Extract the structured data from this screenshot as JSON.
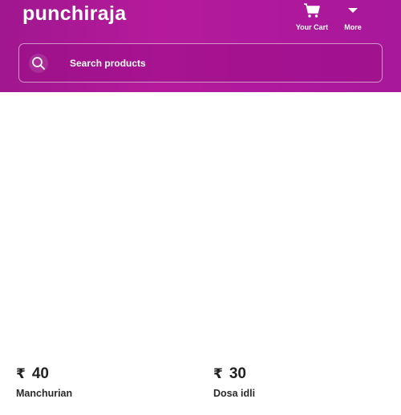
{
  "header": {
    "brand": "punchiraja",
    "nav": {
      "cart_label": "Your Cart",
      "more_label": "More"
    },
    "search": {
      "placeholder": "Search products"
    },
    "colors": {
      "header_bg": "#a8189a",
      "text": "#ffffff"
    }
  },
  "products": [
    {
      "currency": "₹",
      "price": "40",
      "name": "Manchurian"
    },
    {
      "currency": "₹",
      "price": "30",
      "name": "Dosa idli"
    }
  ]
}
